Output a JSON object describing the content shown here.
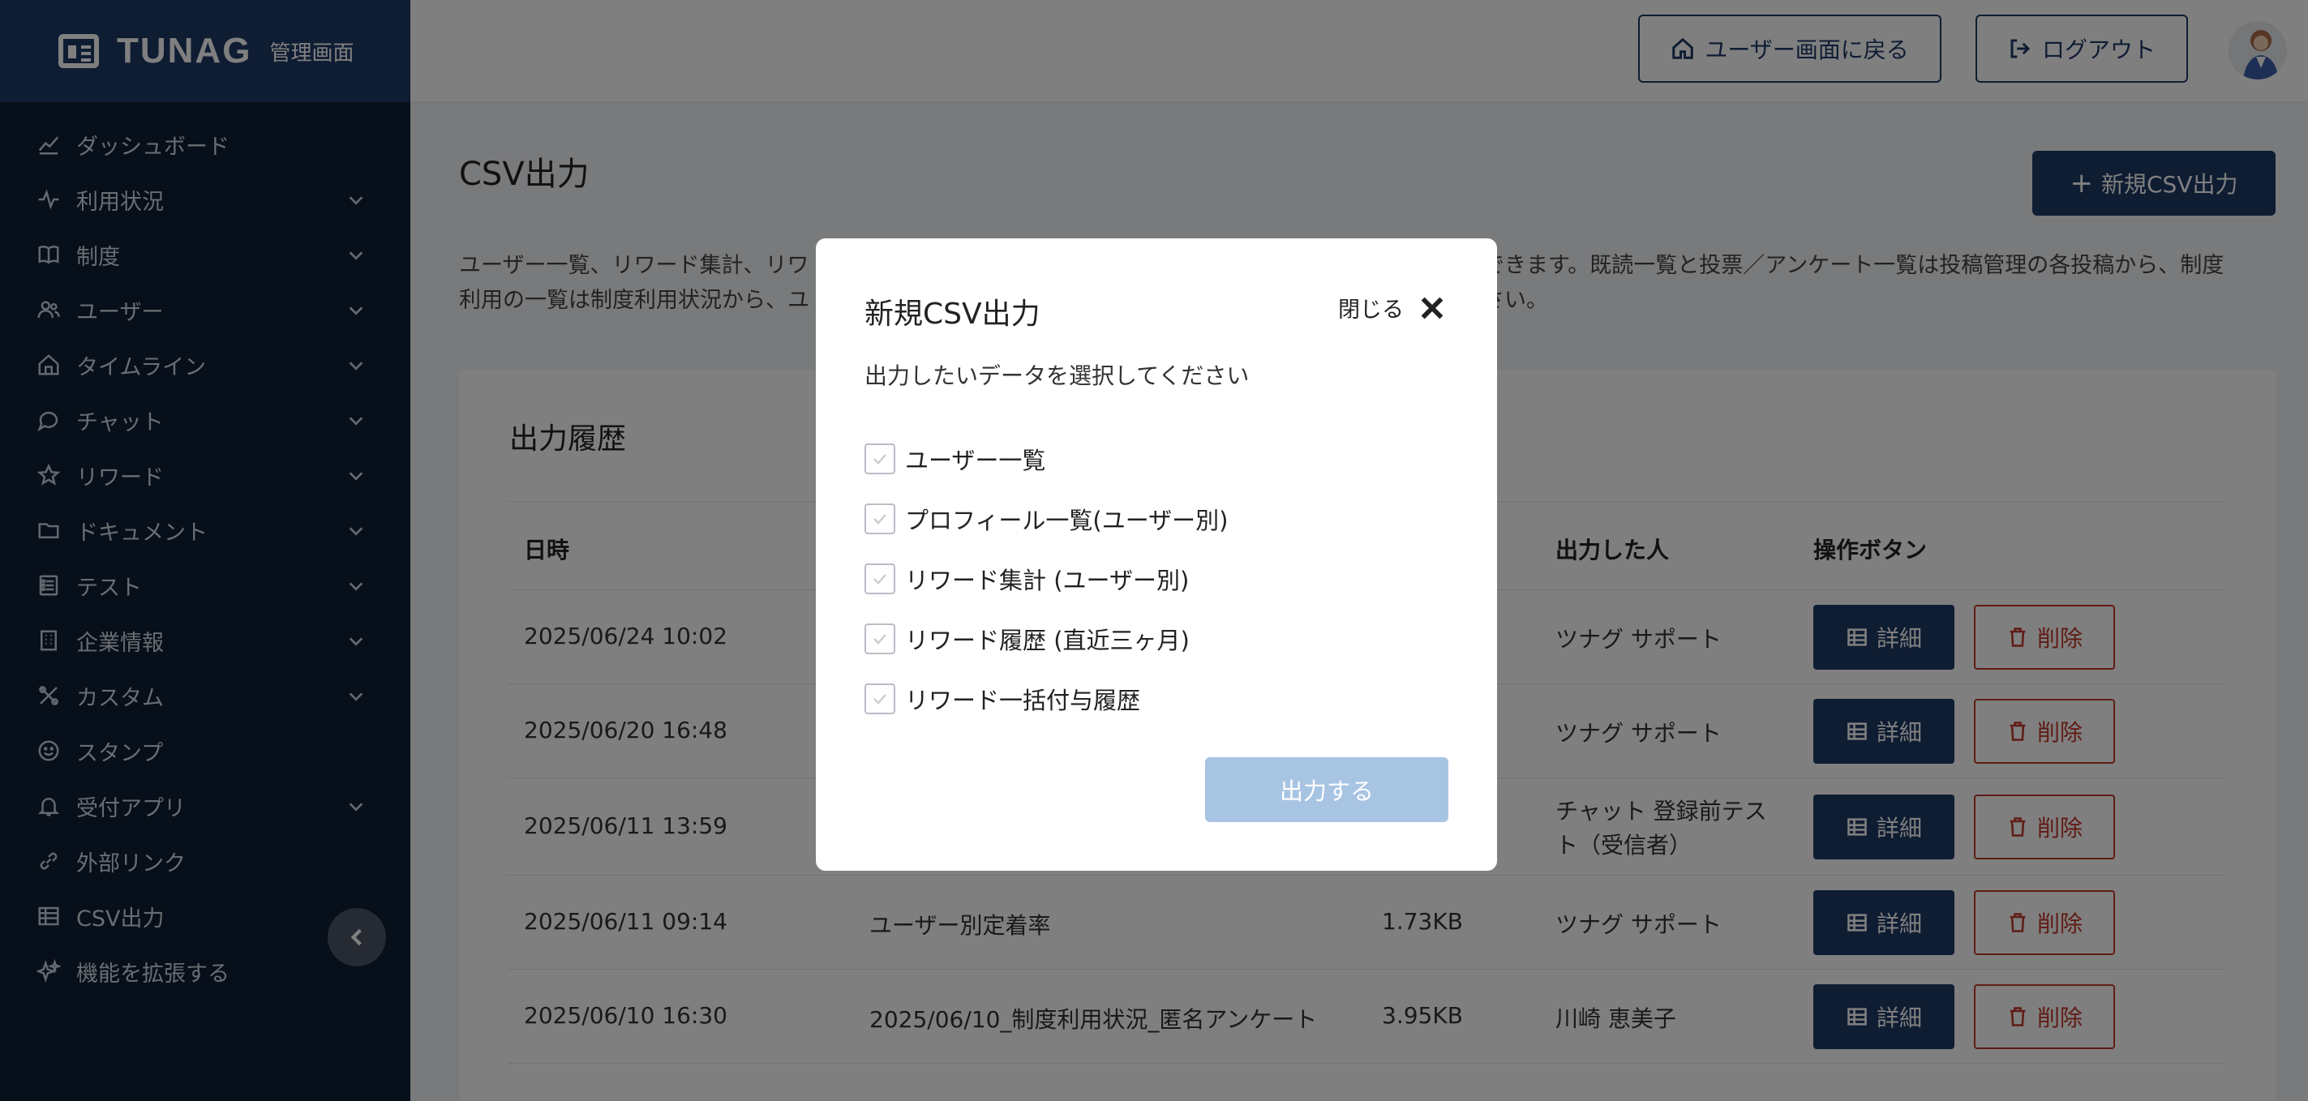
{
  "brand": {
    "name": "TUNAG",
    "subtitle": "管理画面"
  },
  "sidebar": {
    "items": [
      {
        "label": "ダッシュボード",
        "icon": "chart-line-icon",
        "expandable": false
      },
      {
        "label": "利用状況",
        "icon": "activity-icon",
        "expandable": true
      },
      {
        "label": "制度",
        "icon": "book-icon",
        "expandable": true
      },
      {
        "label": "ユーザー",
        "icon": "users-icon",
        "expandable": true
      },
      {
        "label": "タイムライン",
        "icon": "home-icon",
        "expandable": true
      },
      {
        "label": "チャット",
        "icon": "chat-bubble-icon",
        "expandable": true
      },
      {
        "label": "リワード",
        "icon": "star-icon",
        "expandable": true
      },
      {
        "label": "ドキュメント",
        "icon": "folder-icon",
        "expandable": true
      },
      {
        "label": "テスト",
        "icon": "checklist-icon",
        "expandable": true
      },
      {
        "label": "企業情報",
        "icon": "building-icon",
        "expandable": true
      },
      {
        "label": "カスタム",
        "icon": "tools-icon",
        "expandable": true
      },
      {
        "label": "スタンプ",
        "icon": "smiley-icon",
        "expandable": false
      },
      {
        "label": "受付アプリ",
        "icon": "bell-icon",
        "expandable": true
      },
      {
        "label": "外部リンク",
        "icon": "link-icon",
        "expandable": false
      },
      {
        "label": "CSV出力",
        "icon": "table-icon",
        "expandable": false
      },
      {
        "label": "機能を拡張する",
        "icon": "sparkle-icon",
        "expandable": false
      }
    ]
  },
  "header": {
    "back_label": "ユーザー画面に戻る",
    "logout_label": "ログアウト"
  },
  "main": {
    "title": "CSV出力",
    "new_button_label": "新規CSV出力",
    "description_line1": "ユーザー一覧、リワード集計、リワ",
    "description_line1_tail": "できます。既読一覧と投票／アンケート一覧は投稿管理の各投稿から、制度",
    "description_line2": "利用の一覧は制度利用状況から、ユ",
    "description_line2_tail": "さい。",
    "history": {
      "title": "出力履歴",
      "headers": {
        "datetime": "日時",
        "by": "出力した人",
        "actions": "操作ボタン"
      },
      "rows": [
        {
          "datetime": "2025/06/24 10:02",
          "name": "",
          "size": "",
          "by": "ツナグ サポート"
        },
        {
          "datetime": "2025/06/20 16:48",
          "name": "",
          "size": "",
          "by": "ツナグ サポート"
        },
        {
          "datetime": "2025/06/11 13:59",
          "name": "",
          "size": "",
          "by": "チャット 登録前テス\nト（受信者）"
        },
        {
          "datetime": "2025/06/11 09:14",
          "name": "ユーザー別定着率",
          "size": "1.73KB",
          "by": "ツナグ サポート"
        },
        {
          "datetime": "2025/06/10 16:30",
          "name": "2025/06/10_制度利用状況_匿名アンケート",
          "size": "3.95KB",
          "by": "川崎 恵美子"
        }
      ],
      "detail_label": "詳細",
      "delete_label": "削除"
    }
  },
  "modal": {
    "title": "新規CSV出力",
    "close_label": "閉じる",
    "lead": "出力したいデータを選択してください",
    "options": [
      "ユーザー一覧",
      "プロフィール一覧(ユーザー別)",
      "リワード集計 (ユーザー別)",
      "リワード履歴 (直近三ヶ月)",
      "リワード一括付与履歴"
    ],
    "submit_label": "出力する"
  },
  "colors": {
    "navy": "#1e3a66",
    "sidebar_bg": "#0f1e35",
    "danger": "#c0392b",
    "disabled_button": "#a8c4e3"
  }
}
